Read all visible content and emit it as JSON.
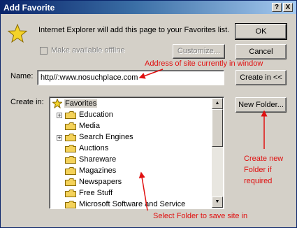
{
  "window": {
    "title": "Add Favorite",
    "help": "?",
    "close": "X"
  },
  "message": "Internet Explorer will add this page to your Favorites list.",
  "offline_label": "Make available offline",
  "buttons": {
    "ok": "OK",
    "cancel": "Cancel",
    "customize": "Customize...",
    "create_in": "Create in <<",
    "new_folder": "New Folder..."
  },
  "name_label": "Name:",
  "name_value": "http//:www.nosuchplace.com",
  "create_in_label": "Create in:",
  "tree": {
    "root": "Favorites",
    "items": [
      "Education",
      "Media",
      "Search Engines",
      "Auctions",
      "Shareware",
      "Magazines",
      "Newspapers",
      "Free Stuff",
      "Microsoft Software and Service"
    ]
  },
  "annotations": {
    "address": "Address of site currently in window",
    "new_folder": "Create new Folder if required",
    "select_folder": "Select Folder to save site in"
  },
  "colors": {
    "folder": "#f4d25a",
    "annotation": "#e01010"
  }
}
